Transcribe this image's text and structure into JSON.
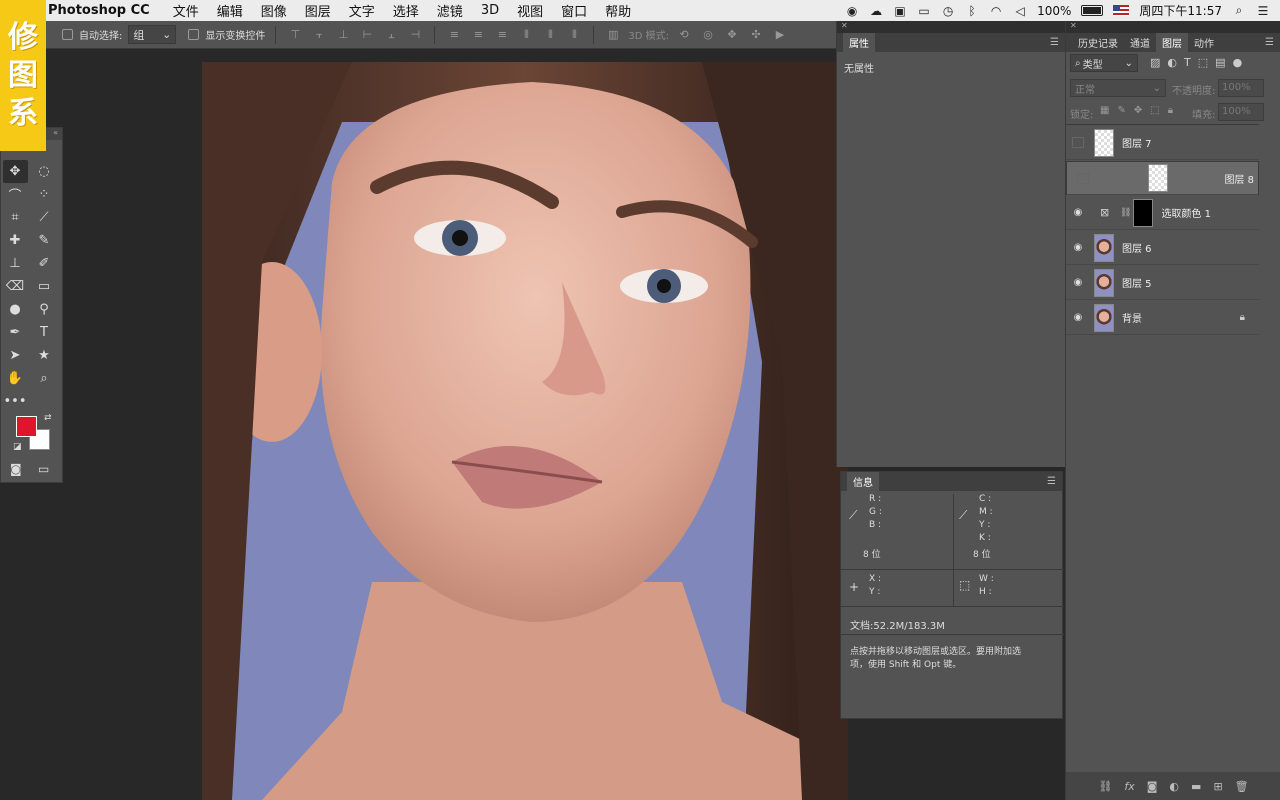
{
  "menubar": {
    "app": "Photoshop CC",
    "items": [
      "文件",
      "编辑",
      "图像",
      "图层",
      "文字",
      "选择",
      "滤镜",
      "3D",
      "视图",
      "窗口",
      "帮助"
    ],
    "battery": "100%",
    "clock": "周四下午11:57"
  },
  "logo": {
    "chars": [
      "修",
      "图",
      "系"
    ]
  },
  "options": {
    "auto_select_label": "自动选择:",
    "auto_select_value": "组",
    "show_transform_label": "显示变换控件",
    "mode_3d_label": "3D 模式:"
  },
  "properties": {
    "tab": "属性",
    "content": "无属性"
  },
  "info": {
    "tab": "信息",
    "rgb_labels": [
      "R :",
      "G :",
      "B :"
    ],
    "cmyk_labels": [
      "C :",
      "M :",
      "Y :",
      "K :"
    ],
    "bit_left": "8 位",
    "bit_right": "8 位",
    "xy_labels": [
      "X :",
      "Y :"
    ],
    "wh_labels": [
      "W :",
      "H :"
    ],
    "doc": "文档:52.2M/183.3M",
    "hint_line1": "点按并拖移以移动图层或选区。要用附加选",
    "hint_line2": "项，使用 Shift 和 Opt 键。"
  },
  "layers_panel": {
    "tabs": [
      "历史记录",
      "通道",
      "图层",
      "动作"
    ],
    "active_tab": "图层",
    "kind_filter": "类型",
    "blend_mode": "正常",
    "opacity_label": "不透明度:",
    "opacity_value": "100%",
    "lock_label": "锁定:",
    "fill_label": "填充:",
    "fill_value": "100%",
    "layers": [
      {
        "name": "图层 7",
        "visible": false,
        "thumb": "transparent"
      },
      {
        "name": "图层 8",
        "visible": false,
        "thumb": "transparent",
        "selected": true
      },
      {
        "name": "选取颜色 1",
        "visible": true,
        "thumb": "adjustment"
      },
      {
        "name": "图层 6",
        "visible": true,
        "thumb": "face"
      },
      {
        "name": "图层 5",
        "visible": true,
        "thumb": "face"
      },
      {
        "name": "背景",
        "visible": true,
        "thumb": "face",
        "locked": true
      }
    ]
  },
  "colors": {
    "foreground": "#e0142c",
    "background": "#ffffff",
    "photo_backdrop": "#7f86b8"
  }
}
